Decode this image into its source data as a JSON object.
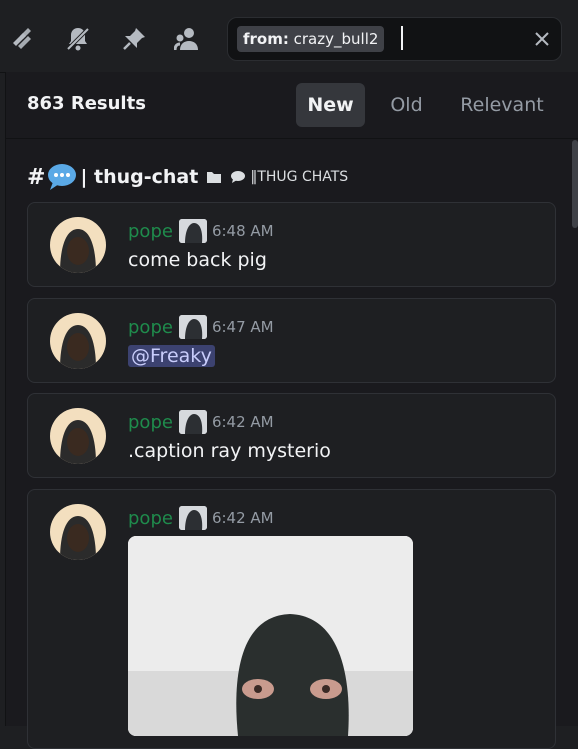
{
  "toolbar": {
    "icons": [
      "threads-icon",
      "mute-notifications-icon",
      "pin-icon",
      "members-icon",
      "clear-icon"
    ]
  },
  "search": {
    "filter_key": "from:",
    "filter_value": "crazy_bull2"
  },
  "results": {
    "count": "863 Results",
    "sort_tabs": [
      {
        "label": "New",
        "active": true
      },
      {
        "label": "Old",
        "active": false
      },
      {
        "label": "Relevant",
        "active": false
      }
    ]
  },
  "channel": {
    "hash": "#",
    "name": "| thug-chat",
    "category": "‖THUG CHATS"
  },
  "messages": [
    {
      "author": "pope",
      "time": "6:48 AM",
      "text": "come back pig"
    },
    {
      "author": "pope",
      "time": "6:47 AM",
      "mention": "@Freaky"
    },
    {
      "author": "pope",
      "time": "6:42 AM",
      "text": ".caption ray mysterio"
    },
    {
      "author": "pope",
      "time": "6:42 AM",
      "has_image": true
    }
  ],
  "colors": {
    "author": "#1f8b4c",
    "mention_bg": "#3c4270",
    "active_tab_bg": "#35373c"
  }
}
